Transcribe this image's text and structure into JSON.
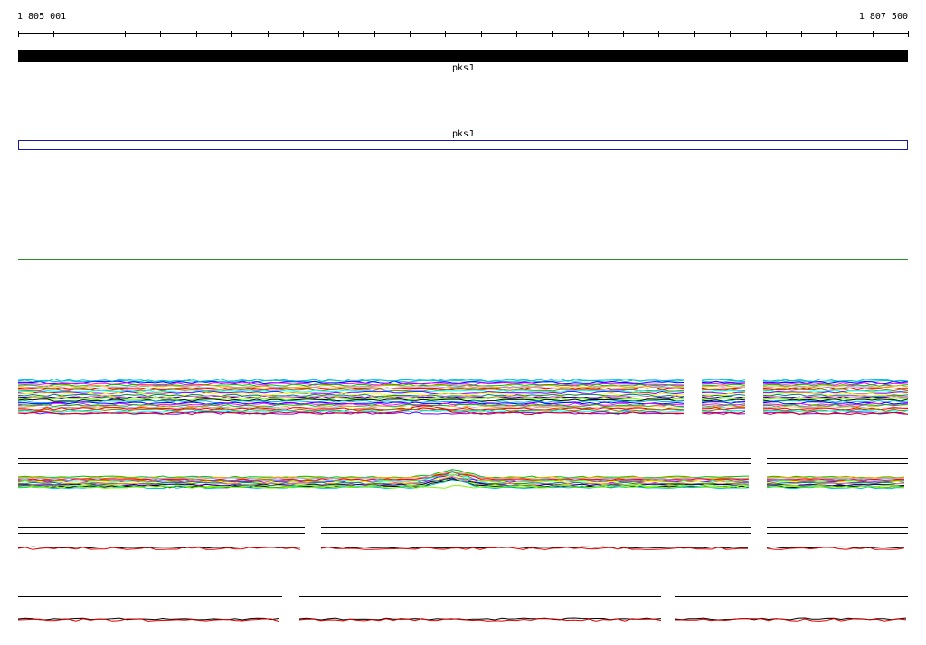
{
  "ruler": {
    "start_label": "1 805 001",
    "end_label": "1 807 500"
  },
  "genes": [
    {
      "name": "pksJ",
      "style": "filled",
      "color": "#000000"
    },
    {
      "name": "pksJ",
      "style": "outline",
      "color": "#1a1aa0"
    }
  ],
  "colors": {
    "axis": "#000000",
    "track_line": "#000000",
    "red_signal": "#e00000",
    "green_signal": "#2c8c2c",
    "palette": [
      "#00bcd4",
      "#0000ff",
      "#ff00ff",
      "#00c000",
      "#ffa500",
      "#a0a0ff",
      "#ff0000",
      "#808000",
      "#00ffff",
      "#8000ff",
      "#ffff00",
      "#008080",
      "#ff69b4",
      "#000080",
      "#7cfc00",
      "#000000"
    ]
  }
}
